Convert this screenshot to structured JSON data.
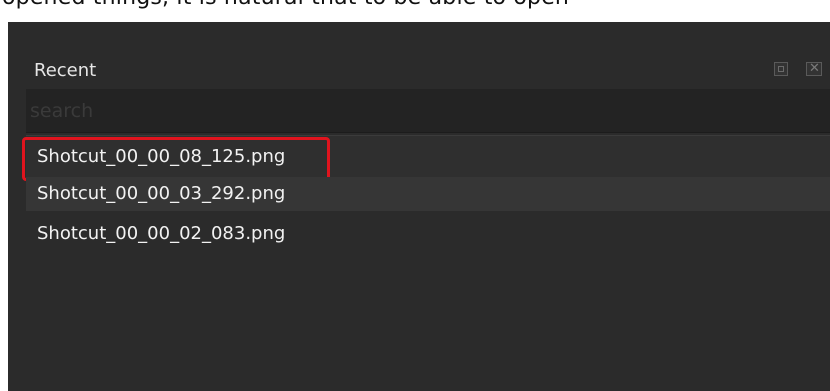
{
  "top_strip": {
    "caption": "opened things, it is natural that to be able to open"
  },
  "recent_panel": {
    "title": "Recent",
    "buttons": {
      "float": "⧉",
      "close": "✕"
    },
    "search": {
      "placeholder": "search",
      "value": ""
    },
    "items": [
      {
        "label": "Shotcut_00_00_08_125.png",
        "highlighted": true
      },
      {
        "label": "Shotcut_00_00_03_292.png",
        "highlighted": false
      },
      {
        "label": "Shotcut_00_00_02_083.png",
        "highlighted": false
      }
    ]
  },
  "colors": {
    "panel_bg": "#2b2b2b",
    "search_bg": "#232323",
    "highlight": "#e0141e",
    "text": "#f2f2f2"
  }
}
